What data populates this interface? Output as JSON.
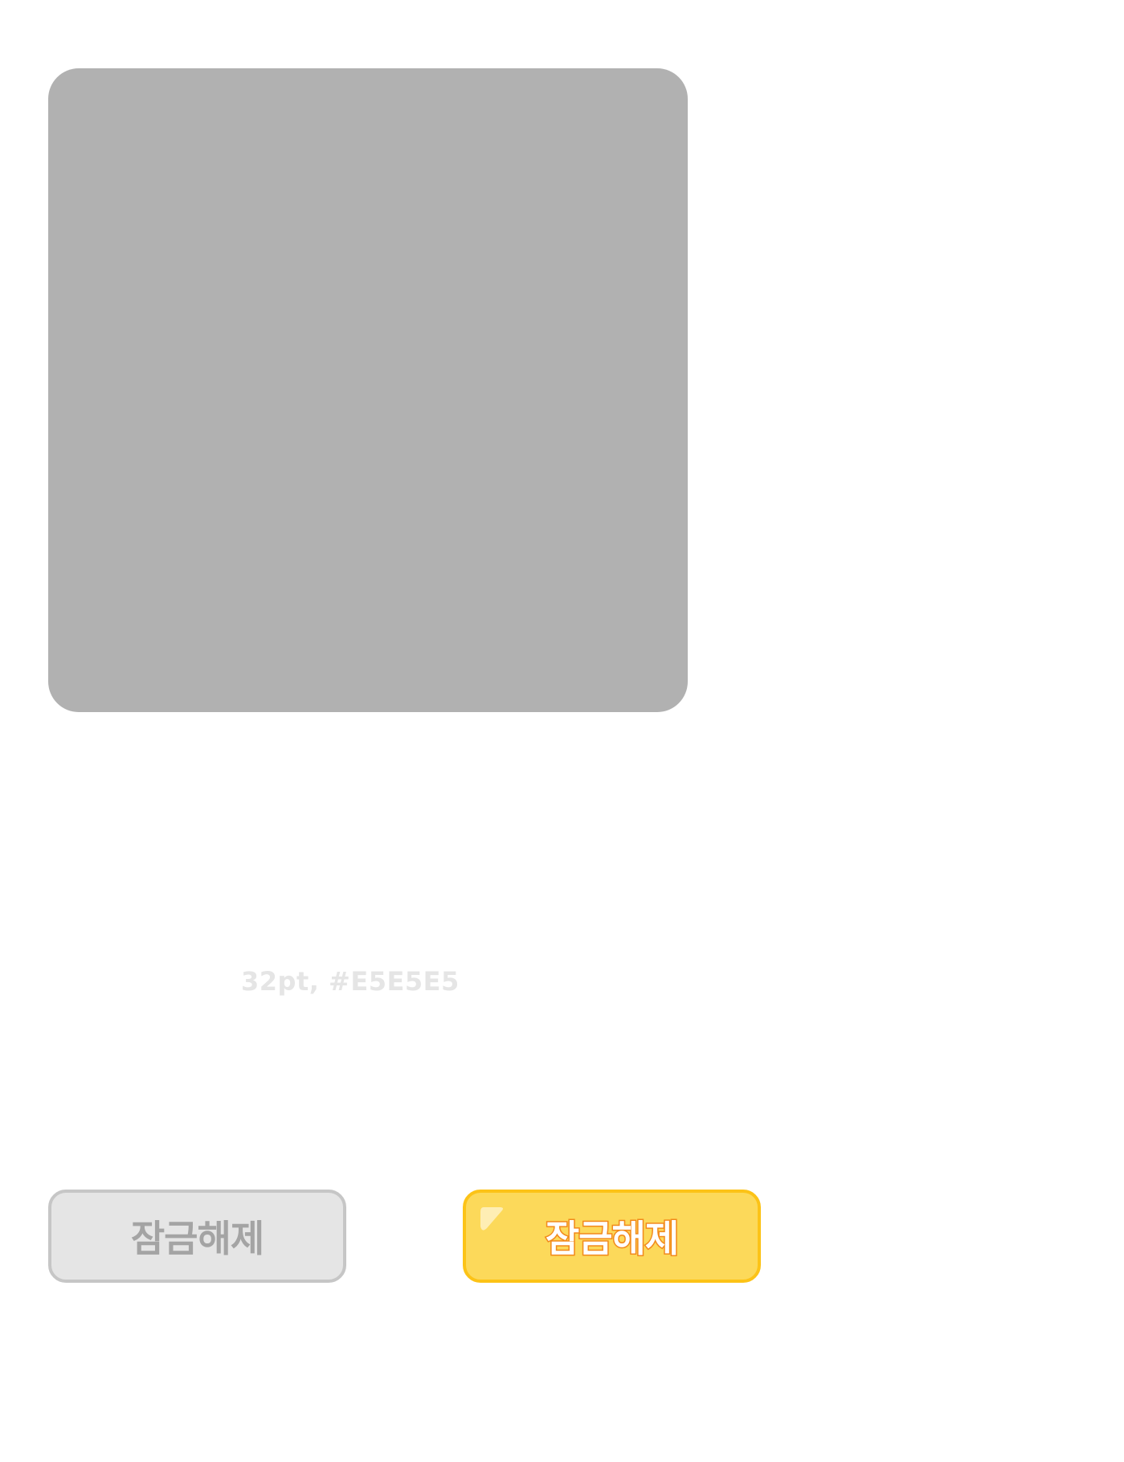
{
  "image_placeholder": {
    "color": "#B1B1B1"
  },
  "caption": {
    "text": "32pt, #E5E5E5",
    "color": "#E5E5E5"
  },
  "buttons": {
    "disabled": {
      "label": "잠금해제",
      "background": "#E5E5E5",
      "border": "#C6C6C6",
      "text_color": "#A4A4A4"
    },
    "active": {
      "label": "잠금해제",
      "background": "#FCD95A",
      "border": "#FCC317",
      "text_color": "#FFFFFF",
      "text_outline": "#F28A1C"
    }
  }
}
